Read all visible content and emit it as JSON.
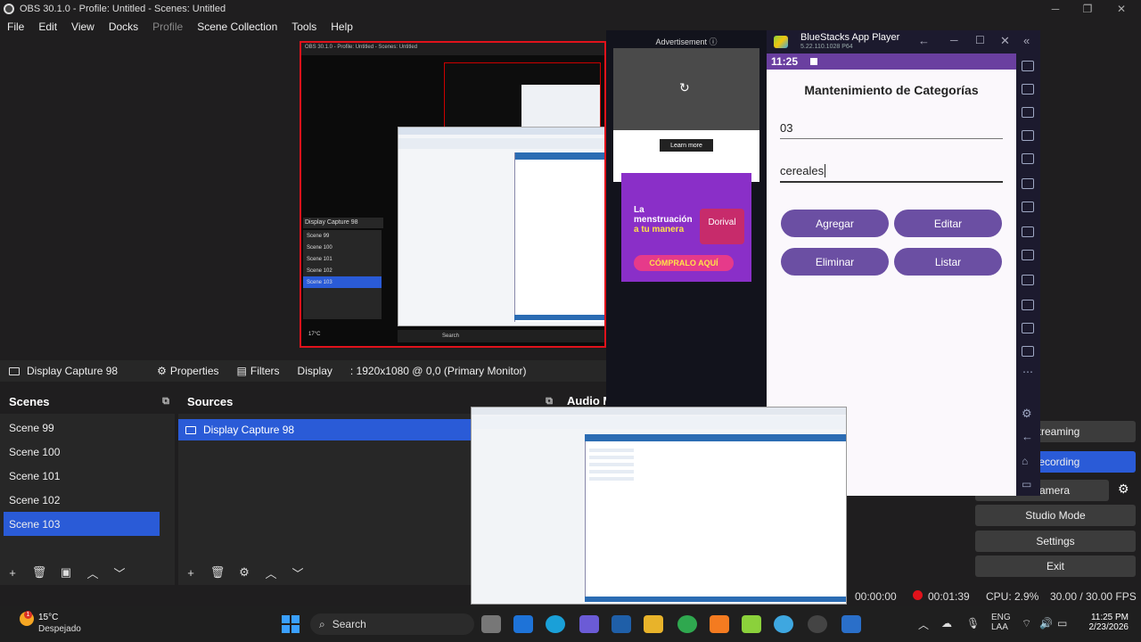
{
  "obs": {
    "title": "OBS 30.1.0 - Profile: Untitled - Scenes: Untitled",
    "menu": [
      "File",
      "Edit",
      "View",
      "Docks",
      "Profile",
      "Scene Collection",
      "Tools",
      "Help"
    ],
    "source_toolbar": {
      "source_name": "Display Capture 98",
      "properties": "Properties",
      "filters": "Filters",
      "display_label": "Display",
      "display_value": ": 1920x1080 @ 0,0 (Primary Monitor)"
    },
    "scenes": {
      "title": "Scenes",
      "items": [
        "Scene 99",
        "Scene 100",
        "Scene 101",
        "Scene 102",
        "Scene 103"
      ],
      "selected": "Scene 103"
    },
    "sources": {
      "title": "Sources",
      "items": [
        "Display Capture 98"
      ]
    },
    "audio_title": "Audio M",
    "controls": {
      "streaming": "Streaming",
      "recording": "Recording",
      "virtual_camera": "ual Camera",
      "studio_mode": "Studio Mode",
      "settings": "Settings",
      "exit": "Exit"
    },
    "status": {
      "stream_time": "00:00:00",
      "rec_time": "00:01:39",
      "cpu": "CPU: 2.9%",
      "fps": "30.00 / 30.00 FPS"
    }
  },
  "ad": {
    "header": "Advertisement",
    "learn_more": "Learn more",
    "banner_line1": "La",
    "banner_line2": "menstruación",
    "banner_line3": "a tu manera",
    "banner_brand": "Dorival",
    "banner_cta": "CÓMPRALO AQUÍ"
  },
  "bluestacks": {
    "title": "BlueStacks App Player",
    "version": "5.22.110.1028  P64",
    "time": "11:25",
    "app_title": "Mantenimiento de Categorías",
    "field_code": "03",
    "field_name": "cereales",
    "buttons": {
      "add": "Agregar",
      "edit": "Editar",
      "delete": "Eliminar",
      "list": "Listar"
    }
  },
  "preview_mini": {
    "scenes": [
      "Scene 99",
      "Scene 100",
      "Scene 101",
      "Scene 102",
      "Scene 103"
    ],
    "source": "Display Capture 98",
    "search": "Search",
    "weather": "17°C"
  },
  "taskbar": {
    "weather_temp": "15°C",
    "weather_desc": "Despejado",
    "weather_badge": "1",
    "search": "Search",
    "lang1": "ENG",
    "lang2": "LAA",
    "clock_time": "11:25 PM",
    "clock_date": "2/23/2026"
  }
}
